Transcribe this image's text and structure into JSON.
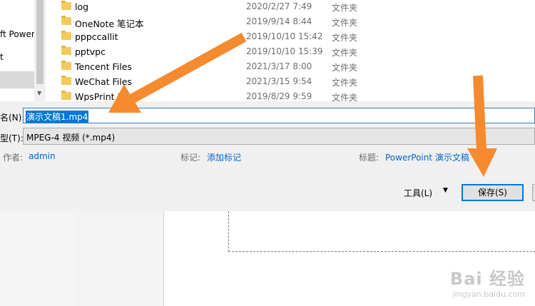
{
  "nav": {
    "items": [
      "ft Power",
      "t"
    ]
  },
  "files": [
    {
      "name": "log",
      "date": "2020/2/27 7:49",
      "type": "文件夹"
    },
    {
      "name": "OneNote 笔记本",
      "date": "2019/9/14 8:44",
      "type": "文件夹"
    },
    {
      "name": "pppccallit",
      "date": "2019/10/10 15:42",
      "type": "文件夹"
    },
    {
      "name": "pptvpc",
      "date": "2019/10/10 15:39",
      "type": "文件夹"
    },
    {
      "name": "Tencent Files",
      "date": "2021/3/17 8:00",
      "type": "文件夹"
    },
    {
      "name": "WeChat Files",
      "date": "2021/3/15 9:54",
      "type": "文件夹"
    },
    {
      "name": "WpsPrint Files",
      "date": "2019/8/29 9:59",
      "type": "文件夹"
    }
  ],
  "form": {
    "filename_label": "名(N):",
    "filename_value": "演示文稿1.mp4",
    "type_label": "型(T):",
    "type_value": "MPEG-4 视频 (*.mp4)",
    "author_label": "作者:",
    "author_value": "admin",
    "tags_label": "标记:",
    "tags_value": "添加标记",
    "title_label": "标题:",
    "title_value": "PowerPoint 演示文稿",
    "tools_label": "工具(L)",
    "save_label": "保存(S)"
  },
  "watermark": {
    "main": "Bai 经验",
    "sub": "jingyan.baidu.com"
  },
  "colors": {
    "arrow": "#f58a2e",
    "selection": "#0078d7",
    "link": "#0066cc"
  }
}
